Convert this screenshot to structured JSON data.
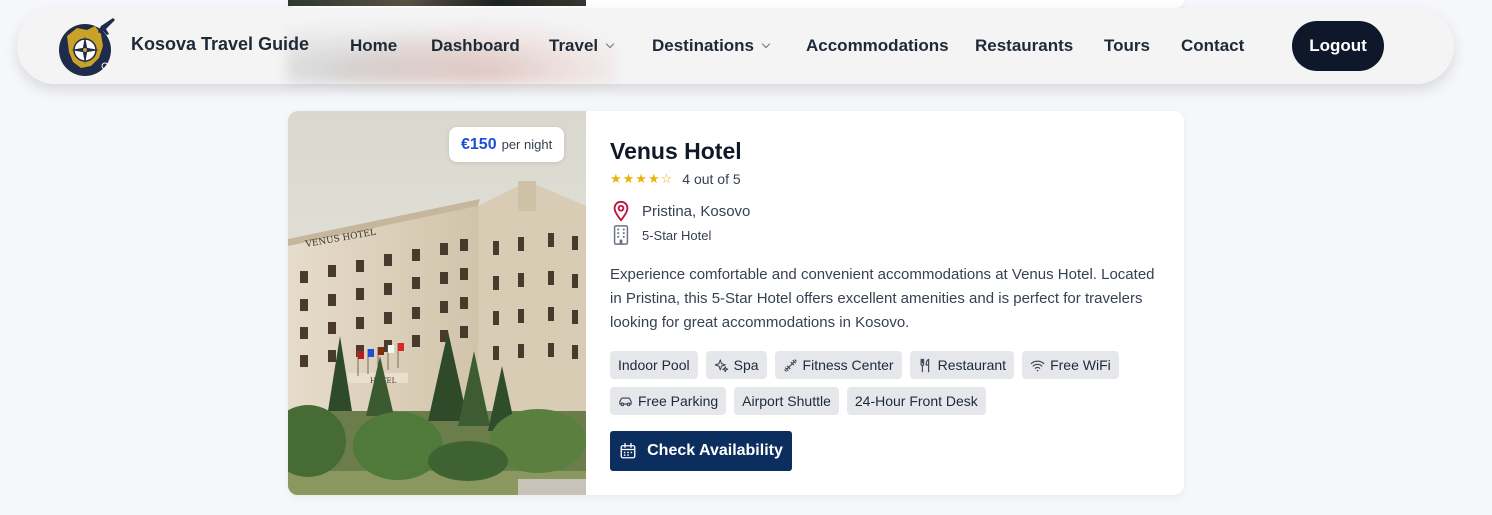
{
  "nav": {
    "brand": "Kosova Travel Guide",
    "items": [
      {
        "label": "Home",
        "dropdown": false
      },
      {
        "label": "Dashboard",
        "dropdown": false
      },
      {
        "label": "Travel",
        "dropdown": true
      },
      {
        "label": "Destinations",
        "dropdown": true
      },
      {
        "label": "Accommodations",
        "dropdown": false
      },
      {
        "label": "Restaurants",
        "dropdown": false
      },
      {
        "label": "Tours",
        "dropdown": false
      },
      {
        "label": "Contact",
        "dropdown": false
      }
    ],
    "logout_label": "Logout"
  },
  "hotel": {
    "price": "€150",
    "price_unit": "per night",
    "name": "Venus Hotel",
    "rating_value": 4,
    "rating_max": 5,
    "rating_text": "4 out of 5",
    "location": "Pristina, Kosovo",
    "type": "5-Star Hotel",
    "description": "Experience comfortable and convenient accommodations at Venus Hotel. Located in Pristina, this 5-Star Hotel offers excellent amenities and is perfect for travelers looking for great accommodations in Kosovo.",
    "photo_sign": "VENUS HOTEL",
    "photo_sign_small": "HOTEL",
    "amenities": [
      {
        "label": "Indoor Pool",
        "icon": ""
      },
      {
        "label": "Spa",
        "icon": "sparkles-icon"
      },
      {
        "label": "Fitness Center",
        "icon": "dumbbell-icon"
      },
      {
        "label": "Restaurant",
        "icon": "utensils-icon"
      },
      {
        "label": "Free WiFi",
        "icon": "wifi-icon"
      },
      {
        "label": "Free Parking",
        "icon": "car-icon"
      },
      {
        "label": "Airport Shuttle",
        "icon": ""
      },
      {
        "label": "24-Hour Front Desk",
        "icon": ""
      }
    ],
    "cta_label": "Check Availability"
  },
  "colors": {
    "accent_price": "#1d4ed8",
    "cta_bg": "#0b2e5e",
    "logout_bg": "#0f172a",
    "star": "#eab308",
    "location_pin": "#be123c"
  }
}
